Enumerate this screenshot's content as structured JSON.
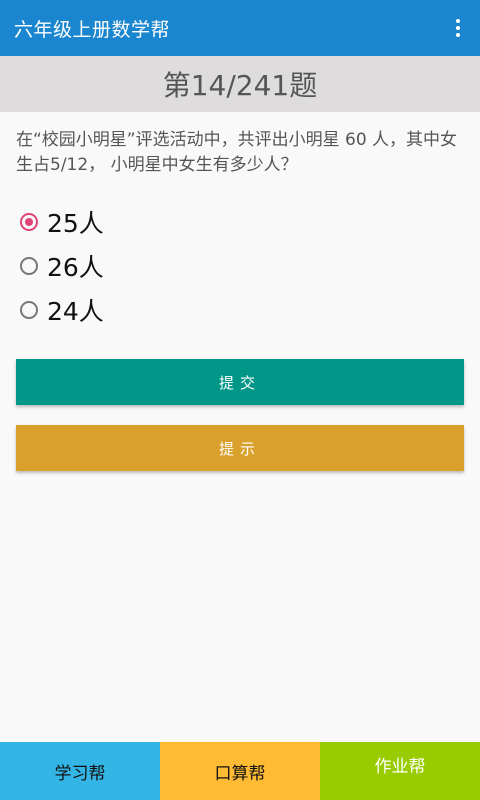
{
  "app_bar": {
    "title": "六年级上册数学帮",
    "menu_icon": "more-vert-icon"
  },
  "header": {
    "question_number": "第14/241题"
  },
  "question": {
    "text": "在“校园小明星”评选活动中，共评出小明星 60 人，其中女生占5/12， 小明星中女生有多少人？"
  },
  "options": [
    {
      "label": "25人",
      "checked": true
    },
    {
      "label": "26人",
      "checked": false
    },
    {
      "label": "24人",
      "checked": false
    }
  ],
  "buttons": {
    "submit_label": "提交",
    "hint_label": "提示"
  },
  "bottom_nav": [
    {
      "label": "学习帮"
    },
    {
      "label": "口算帮"
    },
    {
      "label": "作业帮"
    }
  ],
  "colors": {
    "app_bar": "#1a86cf",
    "submit": "#009688",
    "hint": "#d9a12c",
    "tab1": "#33b5e5",
    "tab2": "#ffbb33",
    "tab3": "#99cc00",
    "radio_checked": "#e0447a"
  }
}
